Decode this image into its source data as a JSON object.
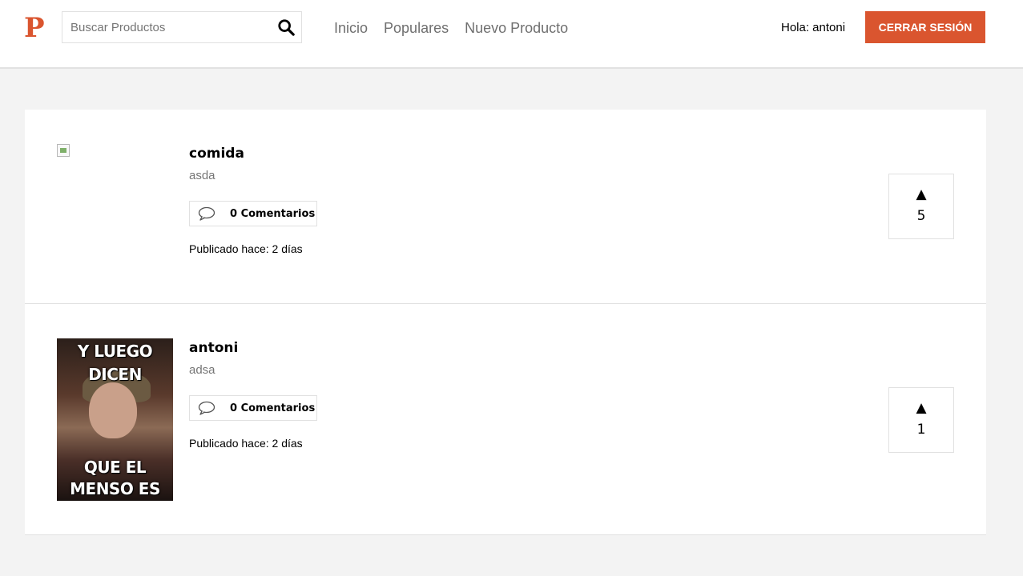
{
  "header": {
    "logo": "P",
    "search_placeholder": "Buscar Productos",
    "nav": [
      "Inicio",
      "Populares",
      "Nuevo Producto"
    ],
    "greeting": "Hola: antoni",
    "logout_label": "CERRAR SESIÓN",
    "accent": "#da552f"
  },
  "products": [
    {
      "title": "comida",
      "description": "asda",
      "comments_label": "0 Comentarios",
      "published": "Publicado hace: 2 días",
      "votes": "5",
      "vote_arrow": "▲"
    },
    {
      "title": "antoni",
      "description": "adsa",
      "comments_label": "0 Comentarios",
      "published": "Publicado hace: 2 días",
      "votes": "1",
      "vote_arrow": "▲",
      "image_text_top": "Y LUEGO DICEN",
      "image_text_bottom": "QUE EL MENSO ES UNO"
    }
  ]
}
